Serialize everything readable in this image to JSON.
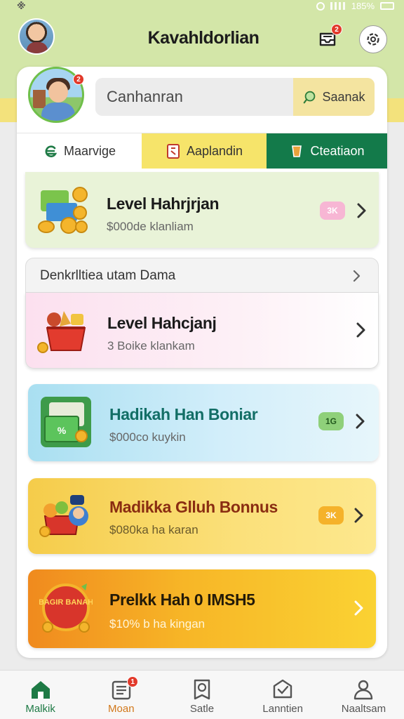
{
  "status_bar": {
    "left": "※",
    "battery": "185%"
  },
  "header": {
    "title": "Kavahldorlian",
    "notification_badge": "2"
  },
  "profile": {
    "badge": "2"
  },
  "search": {
    "placeholder": "Canhanran",
    "button_label": "Saanak"
  },
  "tabs": [
    {
      "label": "Maarvige",
      "icon": "e-swirl-icon",
      "active": false
    },
    {
      "label": "Aaplandin",
      "icon": "clipboard-icon",
      "active": false
    },
    {
      "label": "Cteatiaon",
      "icon": "cup-icon",
      "active": true
    }
  ],
  "cards": [
    {
      "title": "Level Hahrjrjan",
      "subtitle": "$000de klanliam",
      "tag": "3K",
      "thumb": "coins-basket-icon"
    },
    {
      "title": "Level Hahcjanj",
      "subtitle": "3 Boike klankam",
      "thumb": "gift-basket-icon"
    },
    {
      "title": "Hadikah Han Boniar",
      "subtitle": "$000co kuykin",
      "tag": "1G",
      "thumb": "money-bag-icon"
    },
    {
      "title": "Madikka Glluh Bonnus",
      "subtitle": "$080ka ha karan",
      "tag": "3K",
      "thumb": "fruit-basket-icon"
    },
    {
      "title": "Prelkk Hah 0 IMSH5",
      "subtitle": "$10% b ha kingan",
      "thumb": "bonus-ball-icon",
      "thumb_text": "BAGIR BANAH"
    }
  ],
  "section": {
    "title": "Denkrlltiea utam Dama"
  },
  "bottom_nav": [
    {
      "label": "Malkik",
      "icon": "home-icon",
      "active": true
    },
    {
      "label": "Moan",
      "icon": "list-icon",
      "badge": "1"
    },
    {
      "label": "Satle",
      "icon": "search-doc-icon"
    },
    {
      "label": "Lanntien",
      "icon": "box-icon"
    },
    {
      "label": "Naaltsam",
      "icon": "profile-icon"
    }
  ],
  "colors": {
    "primary_green": "#137a4a",
    "accent_yellow": "#f6e46a",
    "badge_red": "#e23a2b",
    "header_bg": "#d3e6a8"
  }
}
